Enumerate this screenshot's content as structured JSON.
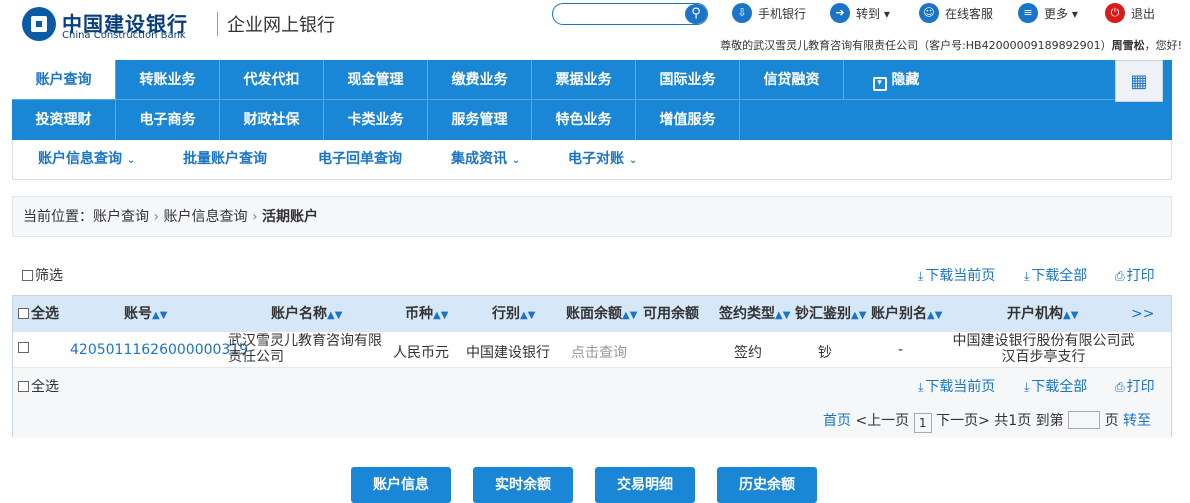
{
  "header": {
    "bank_cn": "中国建设银行",
    "bank_en": "China Construction Bank",
    "site_name": "企业网上银行",
    "search_placeholder": "",
    "links": {
      "mobile": "手机银行",
      "goto": "转到",
      "service": "在线客服",
      "more": "更多",
      "exit": "退出"
    },
    "greeting_prefix": "尊敬的武汉雪灵儿教育咨询有限责任公司（客户号:HB42000009189892901）",
    "greeting_user": "周雪松",
    "greeting_suffix": "，您好!"
  },
  "nav": {
    "row1": [
      "账户查询",
      "转账业务",
      "代发代扣",
      "现金管理",
      "缴费业务",
      "票据业务",
      "国际业务",
      "信贷融资"
    ],
    "hide_label": "隐藏",
    "row2": [
      "投资理财",
      "电子商务",
      "财政社保",
      "卡类业务",
      "服务管理",
      "特色业务",
      "增值服务"
    ]
  },
  "subnav": [
    "账户信息查询",
    "批量账户查询",
    "电子回单查询",
    "集成资讯",
    "电子对账"
  ],
  "breadcrumb": {
    "prefix": "当前位置：",
    "items": [
      "账户查询",
      "账户信息查询",
      "活期账户"
    ]
  },
  "toolbar": {
    "filter": "筛选",
    "download_page": "下载当前页",
    "download_all": "下载全部",
    "print": "打印"
  },
  "table": {
    "select_all": "全选",
    "headers": [
      "账号",
      "账户名称",
      "币种",
      "行别",
      "账面余额",
      "可用余额",
      "签约类型",
      "钞汇鉴别",
      "账户别名",
      "开户机构"
    ],
    "more": ">>",
    "row": {
      "account_no": "42050111626000000319",
      "account_name_1": "武汉雪灵儿教育咨询有限",
      "account_name_2": "责任公司",
      "currency": "人民币元",
      "bank": "中国建设银行",
      "balance": "点击查询",
      "available": "",
      "sign_type": "签约",
      "cash_type": "钞",
      "alias": "-",
      "branch_1": "中国建设银行股份有限公司武",
      "branch_2": "汉百步亭支行"
    }
  },
  "pagination": {
    "first": "首页",
    "prev": "<上一页",
    "current": "1",
    "next": "下一页>",
    "total": "共1页",
    "goto_prefix": "到第",
    "goto_suffix": "页",
    "go": "转至"
  },
  "buttons": [
    "账户信息",
    "实时余额",
    "交易明细",
    "历史余额"
  ],
  "colors": {
    "primary": "#1a86d6",
    "link": "#1a74c7",
    "exit": "#d71c1c"
  }
}
